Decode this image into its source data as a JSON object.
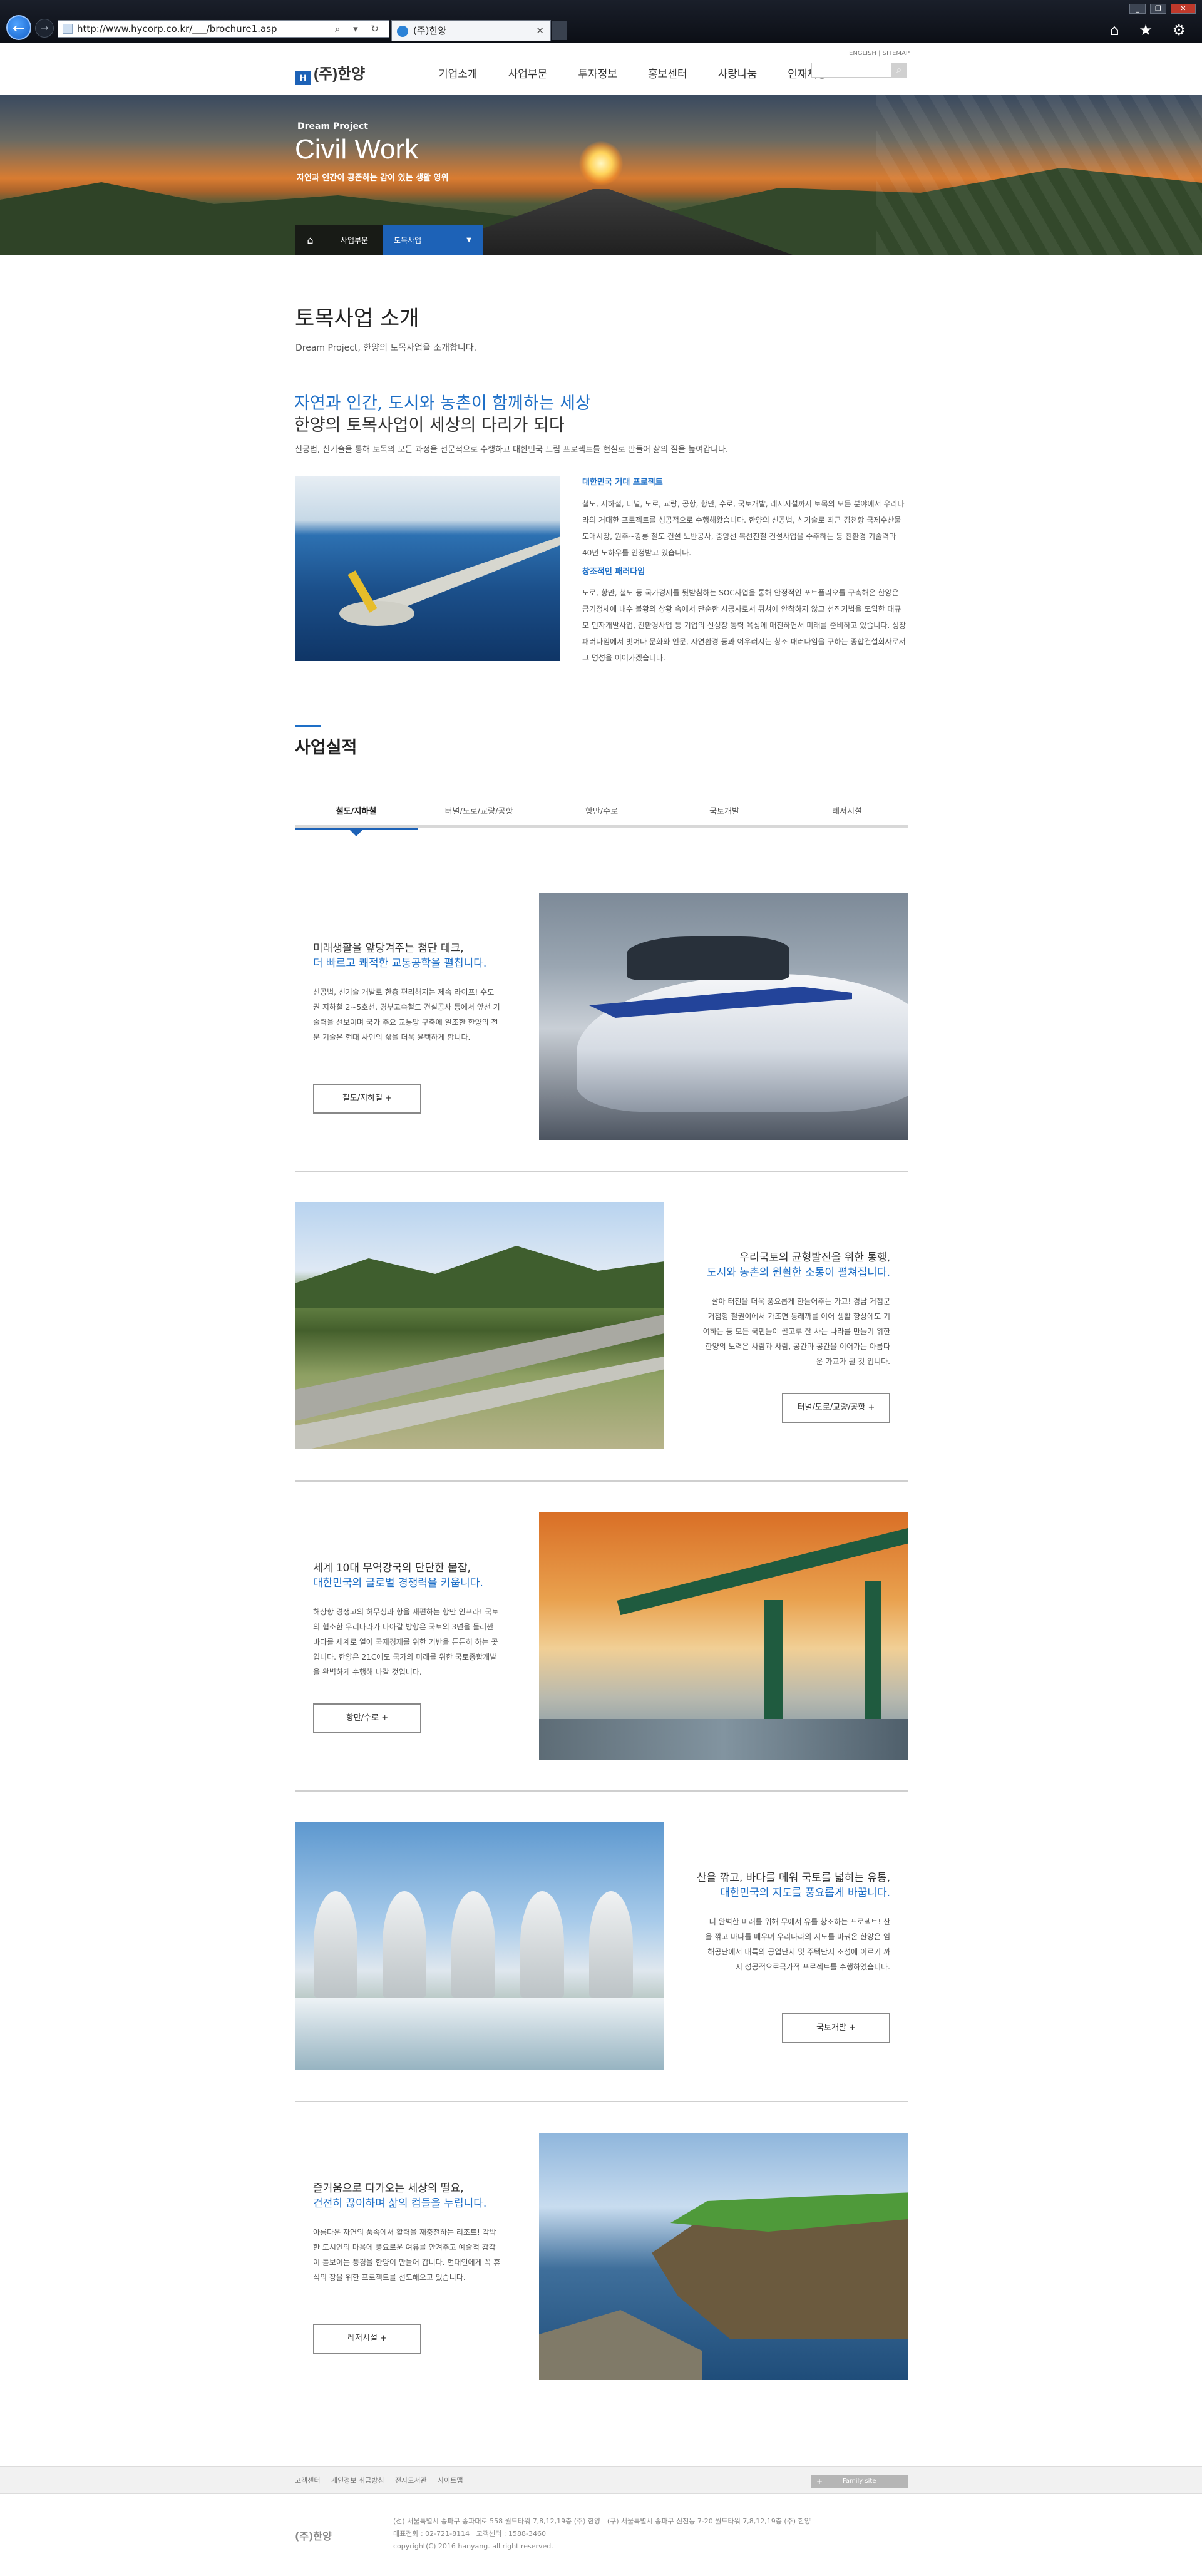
{
  "browser": {
    "url": "http://www.hycorp.co.kr/___/brochure1.asp",
    "tab_title": "(주)한양",
    "back_label": "←",
    "forward_label": "→",
    "address_icons": "⌕ ▾ ↻",
    "tab_close": "✕",
    "window_buttons": [
      "_",
      "❐",
      "✕"
    ],
    "tool_icons": "⌂ ★ ⚙"
  },
  "header": {
    "logo_mark": "H",
    "logo_text": "(주)한양",
    "util_nav": "ENGLISH | SITEMAP",
    "nav": [
      "기업소개",
      "사업부문",
      "투자정보",
      "홍보센터",
      "사랑나눔",
      "인재채용"
    ],
    "search_placeholder": "",
    "search_icon": "⌕"
  },
  "hero": {
    "subtitle": "Dream Project",
    "title": "Civil Work",
    "desc": "자연과 인간이 공존하는 감이 있는 생활 영위",
    "home_icon": "⌂",
    "crumbs": [
      "사업부문",
      "토목사업"
    ],
    "dropdown_icon": "▼"
  },
  "intro": {
    "page_title": "토목사업 소개",
    "page_desc": "Dream Project, 한양의 토목사업을 소개합니다.",
    "slogan_line1": "자연과 인간, 도시와 농촌이 함께하는 세상",
    "slogan_line2": "한양의 토목사업이 세상의 다리가 되다",
    "paragraph": "신공법, 신기술을 통해 토목의 모든 과정을 전문적으로 수행하고 대한민국 드림 프로젝트를 현실로 만들어 삶의 질을 높여갑니다.",
    "tag1": "대한민국 거대 프로젝트",
    "para1": "철도, 지하철, 터널, 도로, 교량, 공항, 항만, 수로, 국토개발, 레저시설까지 토목의 모든 분야에서 우리나라의 거대한 프로젝트를 성공적으로 수행해왔습니다. 한양의 신공법, 신기술로 최근 김천항 국제수산물도매시장, 원주~강릉 철도 건설 노반공사, 중앙선 복선전철 건설사업을 수주하는 등 친환경 기술력과 40년 노하우를 인정받고 있습니다.",
    "tag2": "창조적인 패러다임",
    "para2": "도로, 항만, 철도 등 국가경제를 뒷받침하는 SOC사업을 통해 안정적인 포트폴리오를 구축해온 한양은 금기정체에 내수 불황의 상황 속에서 단순한 시공사로서 뒤쳐에 안착하지 않고 선진기법을 도입한 대규모 민자개발사업, 친환경사업 등 기업의 신성장 동력 육성에 매진하면서 미래를 준비하고 있습니다. 성장 패러다임에서 벗어나 문화와 인문, 자연환경 등과 어우러지는 창조 패러다임을 구하는 종합건설회사로서 그 명성을 이어가겠습니다."
  },
  "section": {
    "title": "사업실적",
    "tabs": [
      "철도/지하철",
      "터널/도로/교량/공항",
      "항만/수로",
      "국토개발",
      "레저시설"
    ]
  },
  "rows": [
    {
      "head1": "미래생활을 앞당겨주는 첨단 테크,",
      "head2": "더 빠르고 쾌적한 교통공학을 펼칩니다.",
      "body": "신공법, 신기술 개발로 한층 편리해지는 제속 라이프! 수도권 지하철 2~5호선, 경부고속철도 건설공사 등에서 앞선 기술력을 선보이며 국가 주요 교통망 구축에 일조한 한양의 전문 기술은 현대 사인의 삶을 더욱 윤택하게 합니다.",
      "button": "철도/지하철  +"
    },
    {
      "head1": "우리국토의 균형발전을 위한 통행,",
      "head2": "도시와 농촌의 원활한 소통이 펼쳐집니다.",
      "body": "살아 터전을 더욱 풍요롭게 한들어주는 가교! 경남 거점군 거점형 철권이에서 가조면 동래까를 이어 생활 향상에도 기여하는 등 모든 국민들이 골고루 잘 사는 나라를 만들기 위한 한양의 노력은 사람과 사람, 공간과 공간을 이어가는 아름다운 가교가 될 것 입니다.",
      "button": "터널/도로/교량/공항  +"
    },
    {
      "head1": "세계 10대 무역강국의 단단한 붙잡,",
      "head2": "대한민국의 글로벌 경쟁력을 키웁니다.",
      "body": "해상항 경쟁고의 허무싱과 항을 재편하는 항만 인프라! 국토의 협소한 우리나라가 나아갈 방향은 국토의 3면을 둘러싼 바다를 세계로 열어 국제경제를 위한 기반을 튼튼히 하는 곳 입니다. 한양은 21C에도 국가의 미래를 위한 국토종합개발을 완벽하게 수행해 나갈 것입니다.",
      "button": "항만/수로  +"
    },
    {
      "head1": "산을 깎고, 바다를 메워 국토를 넓히는 유통,",
      "head2": "대한민국의 지도를 풍요롭게 바꿉니다.",
      "body": "더 완벽한 미래를 위해 무에서 유를 창조하는 프로젝트! 산을 깎고 바다를 메우며 우리나라의 지도를 바꿔온 한양은 임해공단에서 내륙의 공업단지 및 주택단지 조성에 이르기 까지 성공적으로국가적 프로젝트를 수행하였습니다.",
      "button": "국토개발  +"
    },
    {
      "head1": "즐거움으로 다가오는 세상의 떨요,",
      "head2": "건전히 끊이하며 삶의 컴들을 누립니다.",
      "body": "아름다운 자연의 품속에서 활력을 재충전하는 리조트! 각박한 도시인의 마음에 풍요로운 여유를 안겨주고 예술적 감각이 돋보이는 풍경을 한양이 만들어 갑니다. 현대인에게 꼭 휴식의 장을 위한 프로젝트를 선도해오고 있습니다.",
      "button": "레저시설  +"
    }
  ],
  "footer": {
    "links": [
      "고객센터",
      "개인정보 취급방침",
      "전자도서관",
      "사이트맵"
    ],
    "family_site": "Family site",
    "family_plus": "+",
    "logo": "(주)한양",
    "addr1": "(선) 서울특별시 송파구 송파대로 558 월드타워 7,8,12,19층 (주) 한양  |  (구) 서울특별시 송파구 신천동 7-20 월드타워 7,8,12,19층 (주) 한양",
    "addr2": "대표전화 : 02-721-8114  |  고객센터 : 1588-3460",
    "copyright": "copyright(C) 2016 hanyang. all right reserved."
  }
}
